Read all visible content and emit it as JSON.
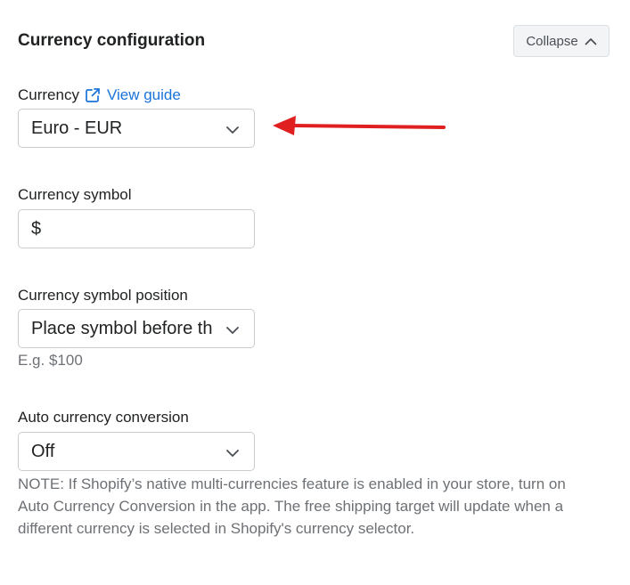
{
  "section": {
    "title": "Currency configuration",
    "collapse_label": "Collapse"
  },
  "currency": {
    "label": "Currency",
    "guide_link": "View guide",
    "value": "Euro - EUR"
  },
  "currency_symbol": {
    "label": "Currency symbol",
    "value": "$"
  },
  "symbol_position": {
    "label": "Currency symbol position",
    "value": "Place symbol before th",
    "hint": "E.g. $100"
  },
  "auto_conversion": {
    "label": "Auto currency conversion",
    "value": "Off",
    "note": "NOTE: If Shopify’s native multi-currencies feature is enabled in your store, turn on Auto Currency Conversion in the app. The free shipping target will update when a different currency is selected in Shopify's currency selector."
  },
  "icons": {
    "collapse": "chevron-up-icon",
    "guide": "external-link-icon",
    "select": "chevron-down-icon",
    "annotation": "red-arrow"
  },
  "colors": {
    "link": "#1a73d9",
    "arrow": "#e02020",
    "hint_text": "#6d7175",
    "border": "#c9cccf"
  }
}
